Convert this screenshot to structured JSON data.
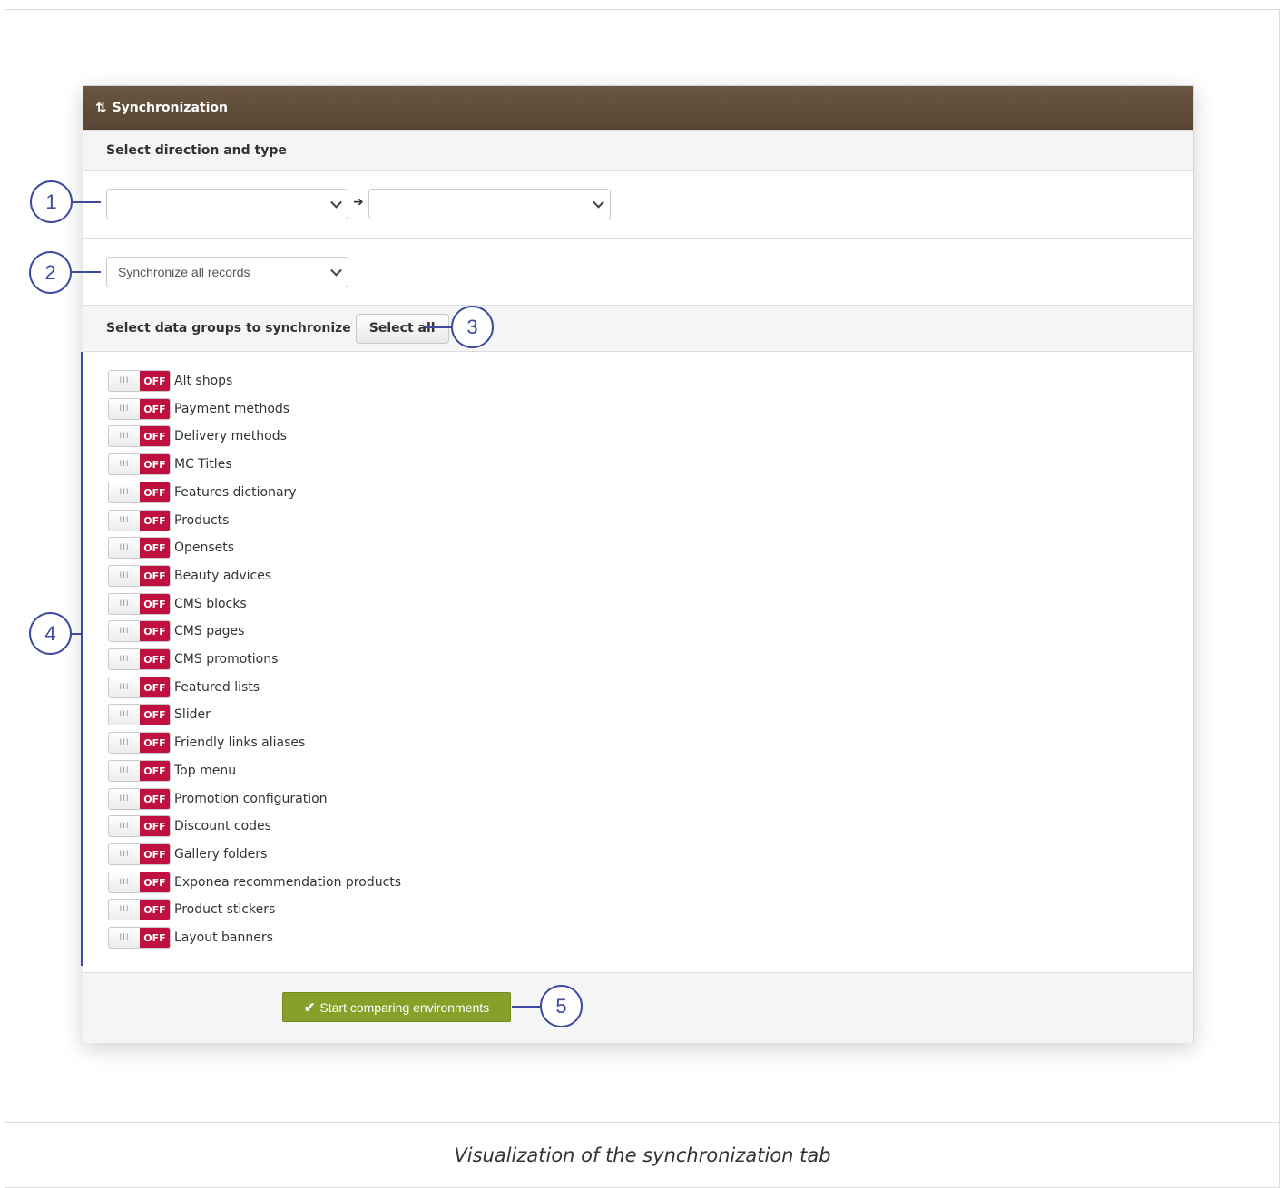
{
  "panel": {
    "title": "Synchronization",
    "title_icon": "sync-icon"
  },
  "direction": {
    "heading": "Select direction and type",
    "source_value": "",
    "target_value": ""
  },
  "sync_type": {
    "selected": "Synchronize all records"
  },
  "groups_section": {
    "heading": "Select data groups to synchronize",
    "select_all_label": "Select all"
  },
  "toggle": {
    "handle_glyph": "III",
    "state_label": "OFF",
    "off_color": "#c0103f"
  },
  "groups": [
    "Alt shops",
    "Payment methods",
    "Delivery methods",
    "MC Titles",
    "Features dictionary",
    "Products",
    "Opensets",
    "Beauty advices",
    "CMS blocks",
    "CMS pages",
    "CMS promotions",
    "Featured lists",
    "Slider",
    "Friendly links aliases",
    "Top menu",
    "Promotion configuration",
    "Discount codes",
    "Gallery folders",
    "Exponea recommendation products",
    "Product stickers",
    "Layout banners"
  ],
  "footer": {
    "start_label": "Start comparing environments",
    "start_color": "#88a02a"
  },
  "callouts": [
    "1",
    "2",
    "3",
    "4",
    "5"
  ],
  "callout_color": "#3d4aa0",
  "caption": "Visualization of the synchronization tab"
}
